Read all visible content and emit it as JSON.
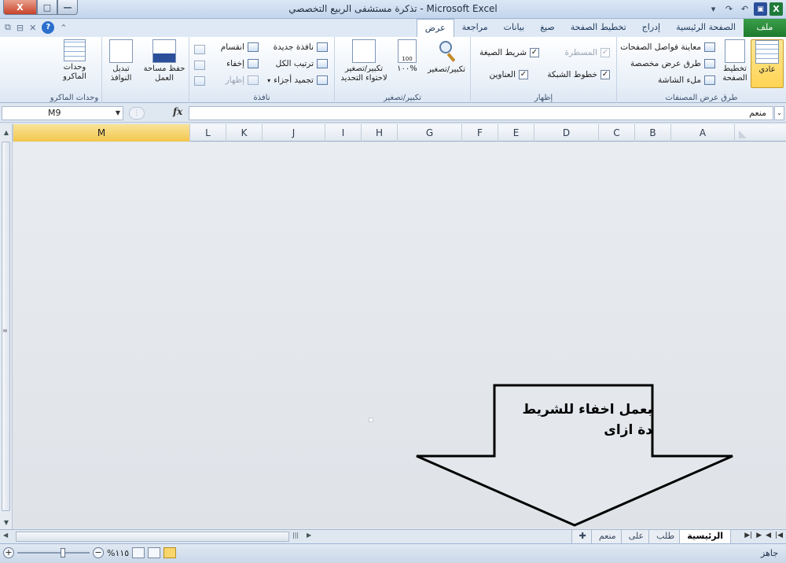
{
  "window": {
    "title": "تذكرة مستشفى الربيع التخصصي - Microsoft Excel",
    "close": "X",
    "maximize": "□",
    "minimize": "—"
  },
  "qat": {
    "app": "X",
    "save": "▣",
    "undo": "↶",
    "redo": "↷",
    "more": "▾"
  },
  "tabs": [
    {
      "label": "ملف",
      "kind": "file"
    },
    {
      "label": "الصفحة الرئيسية"
    },
    {
      "label": "إدراج"
    },
    {
      "label": "تخطيط الصفحة"
    },
    {
      "label": "صيغ"
    },
    {
      "label": "بيانات"
    },
    {
      "label": "مراجعة"
    },
    {
      "label": "عرض",
      "active": true
    }
  ],
  "ribbon": {
    "workbook_views": {
      "label": "طرق عرض المصنفات",
      "normal": "عادي",
      "page_layout": "تخطيط الصفحة",
      "page_break": "معاينة فواصل الصفحات",
      "custom_views": "طرق عرض مخصصة",
      "full_screen": "ملء الشاشة"
    },
    "show": {
      "label": "إظهار",
      "ruler": "المسطرة",
      "formula_bar": "شريط الصيغة",
      "gridlines": "خطوط الشبكة",
      "headings": "العناوين"
    },
    "zoom": {
      "label": "تكبير/تصغير",
      "zoom": "تكبير/تصغير",
      "hundred": "١٠٠%",
      "zoom_selection": "تكبير/تصغير لاحتواء التحديد"
    },
    "window": {
      "label": "نافذة",
      "new_window": "نافذة جديدة",
      "arrange_all": "ترتيب الكل",
      "freeze_panes": "تجميد أجزاء",
      "split": "انقسام",
      "hide": "إخفاء",
      "unhide": "إظهار",
      "save_workspace": "حفظ مساحة العمل",
      "switch_windows": "تبديل النوافذ"
    },
    "macros": {
      "label": "وحدات الماكرو",
      "macros": "وحدات الماكرو"
    }
  },
  "formula_bar": {
    "name_box": "M9",
    "fx": "fx",
    "value": "منعم"
  },
  "columns": [
    "A",
    "B",
    "C",
    "D",
    "E",
    "F",
    "G",
    "H",
    "I",
    "J",
    "K",
    "L",
    "M"
  ],
  "active_column": "M",
  "sheets": [
    {
      "label": "الرئيسية",
      "active": true
    },
    {
      "label": "طلب"
    },
    {
      "label": "على"
    },
    {
      "label": "منعم"
    }
  ],
  "status": {
    "ready": "جاهز",
    "zoom": "%١١٥"
  },
  "annotation": {
    "line1": "بعمل اخفاء للشريط",
    "line2": "دة ازاى"
  }
}
